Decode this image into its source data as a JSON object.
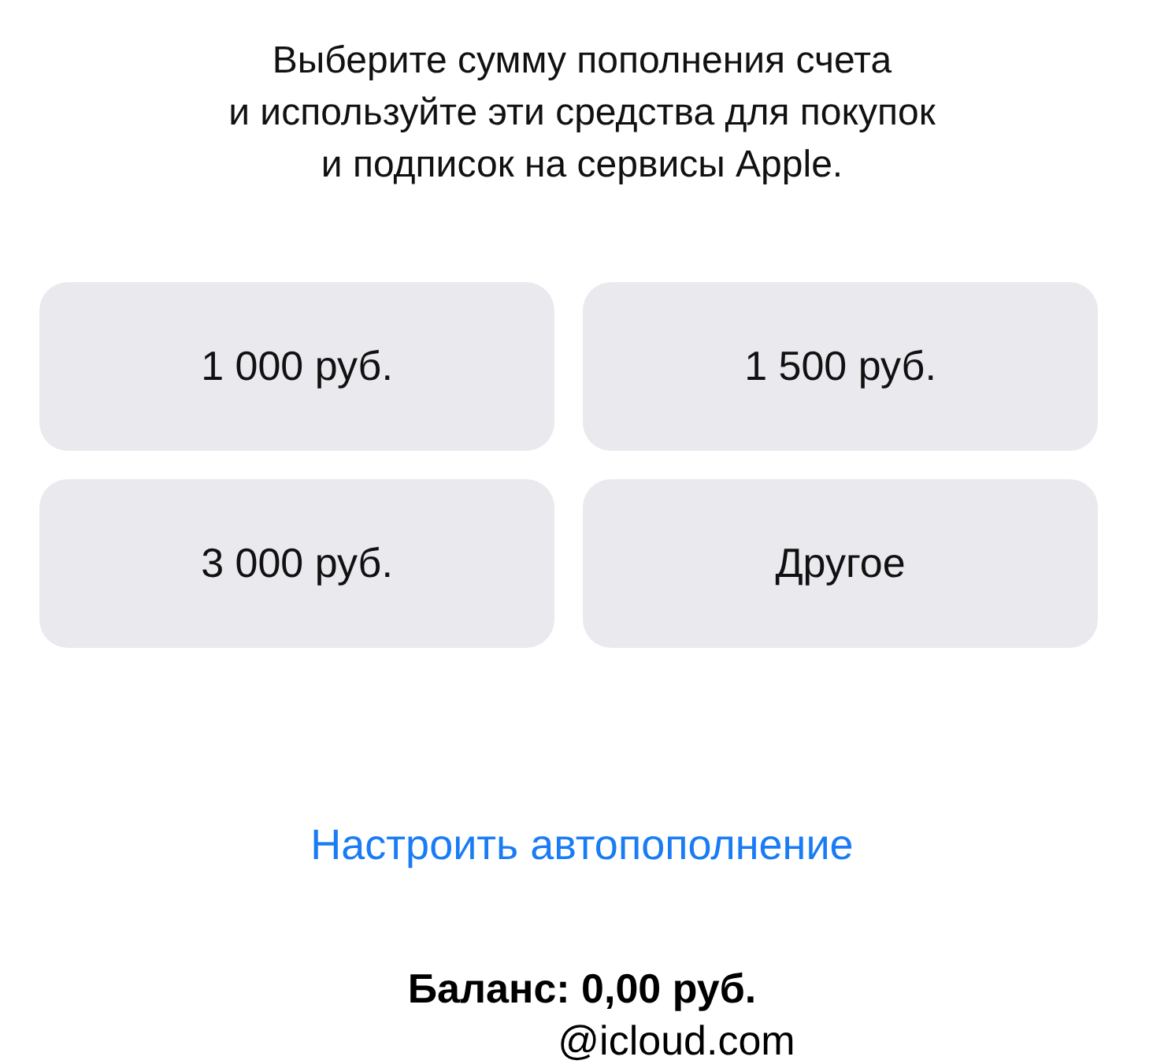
{
  "intro": "Выберите сумму пополнения счета\nи используйте эти средства для покупок\nи подписок на сервисы Apple.",
  "amounts": [
    {
      "label": "1 000 руб."
    },
    {
      "label": "1 500 руб."
    },
    {
      "label": "3 000 руб."
    },
    {
      "label": "Другое"
    }
  ],
  "autofill_link": "Настроить автопополнение",
  "balance": "Баланс: 0,00 руб.",
  "account": "@icloud.com"
}
